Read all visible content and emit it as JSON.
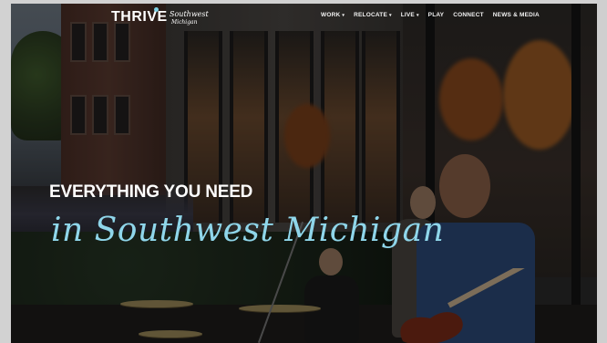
{
  "header": {
    "logo": {
      "main": "THRIVE",
      "sub_line1": "Southwest",
      "sub_line2": "Michigan"
    },
    "nav": [
      {
        "label": "WORK",
        "has_dropdown": true
      },
      {
        "label": "RELOCATE",
        "has_dropdown": true
      },
      {
        "label": "LIVE",
        "has_dropdown": true
      },
      {
        "label": "PLAY",
        "has_dropdown": false
      },
      {
        "label": "CONNECT",
        "has_dropdown": false
      },
      {
        "label": "NEWS & MEDIA",
        "has_dropdown": false
      }
    ]
  },
  "hero": {
    "headline": "EVERYTHING YOU NEED",
    "script_line": "in Southwest Michigan"
  },
  "colors": {
    "accent_script": "#8fd6ea",
    "text_primary": "#ffffff"
  },
  "icons": {
    "dropdown": "chevron-down-icon"
  }
}
